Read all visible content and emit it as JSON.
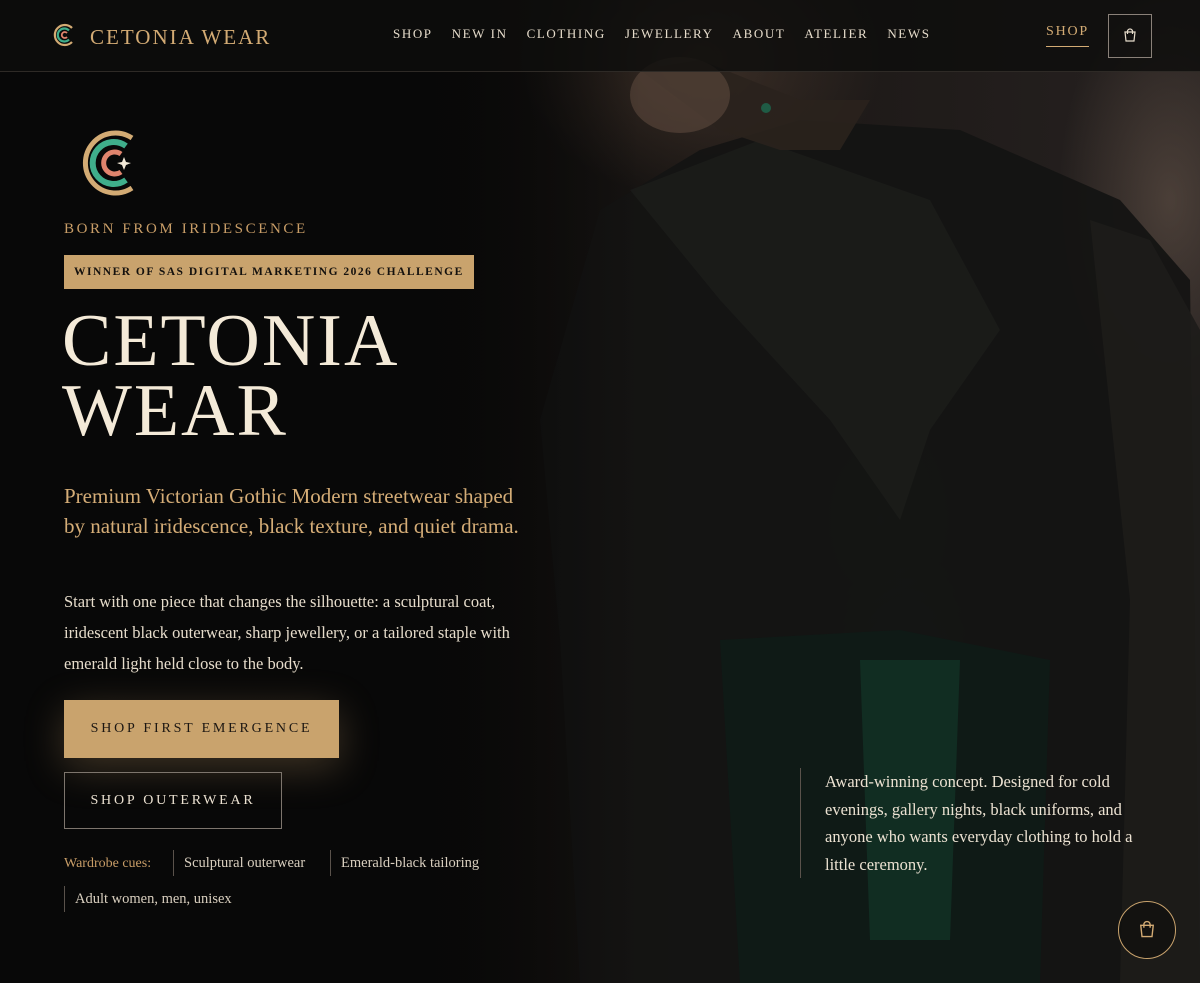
{
  "brand": {
    "name": "CETONIA WEAR",
    "icon": "cetonia-logo-icon"
  },
  "nav": {
    "items": [
      "SHOP",
      "NEW IN",
      "CLOTHING",
      "JEWELLERY",
      "ABOUT",
      "ATELIER",
      "NEWS"
    ]
  },
  "header": {
    "shop_label": "SHOP",
    "cart_icon": "shopping-bag-icon"
  },
  "hero": {
    "eyebrow": "BORN FROM IRIDESCENCE",
    "award": "WINNER OF SAS DIGITAL MARKETING 2026 CHALLENGE",
    "title_line1": "CETONIA",
    "title_line2": "WEAR",
    "lead": "Premium Victorian Gothic Modern streetwear shaped by natural iridescence, black texture, and quiet drama.",
    "body": "Start with one piece that changes the silhouette: a sculptural coat, iridescent black outerwear, sharp jewellery, or a tailored staple with emerald light held close to the body.",
    "primary_cta": "SHOP FIRST EMERGENCE",
    "secondary_cta": "SHOP OUTERWEAR",
    "cues_label": "Wardrobe cues:",
    "cues": [
      "Sculptural outerwear",
      "Emerald-black tailoring",
      "Adult women, men, unisex"
    ],
    "side_note": "Award-winning concept. Designed for cold evenings, gallery nights, black uniforms, and anyone who wants everyday clothing to hold a little ceremony."
  },
  "floating_cart": {
    "icon": "shopping-bag-icon"
  },
  "colors": {
    "accent": "#c9a36d",
    "background": "#0b0a09",
    "text": "#e9dfd0"
  }
}
